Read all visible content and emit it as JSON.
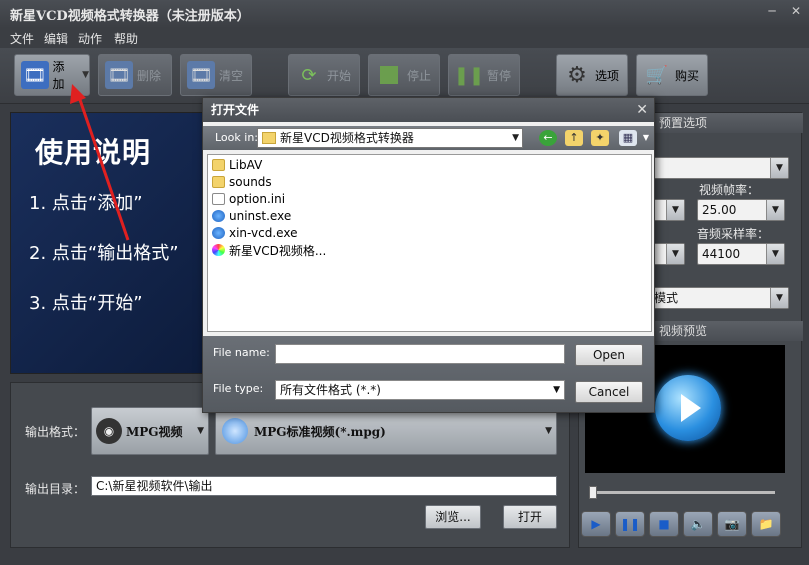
{
  "window": {
    "title": "新星VCD视频格式转换器（未注册版本）"
  },
  "menu": [
    "文件",
    "编辑",
    "动作",
    "帮助"
  ],
  "toolbar": {
    "add": "添加",
    "delete": "删除",
    "clear": "清空",
    "start": "开始",
    "stop": "停止",
    "pause": "暂停",
    "options": "选项",
    "buy": "购买"
  },
  "instructions": {
    "title": "使用说明",
    "step1": "1. 点击“添加”",
    "step2": "2. 点击“输出格式”",
    "step3": "3. 点击“开始”"
  },
  "output": {
    "format_label": "输出格式：",
    "format_value": "MPG视频",
    "preset_value": "MPG标准视频(*.mpg)",
    "dir_label": "输出目录：",
    "dir_value": "C:\\新星视频软件\\输出",
    "browse": "浏览...",
    "open": "打开"
  },
  "right": {
    "preset_header": "预置选项",
    "preset_combo": "",
    "framerate_label": "视频帧率：",
    "framerate_value": "25.00",
    "samplerate_label": "音频采样率：",
    "samplerate_value": "44100",
    "mode_value": "模式",
    "preview_header": "视频预览"
  },
  "dialog": {
    "title": "打开文件",
    "look_in_label": "Look in:",
    "look_in_value": "新星VCD视频格式转换器",
    "files": [
      {
        "name": "LibAV",
        "type": "folder"
      },
      {
        "name": "sounds",
        "type": "folder"
      },
      {
        "name": "option.ini",
        "type": "doc"
      },
      {
        "name": "uninst.exe",
        "type": "app"
      },
      {
        "name": "xin-vcd.exe",
        "type": "app"
      },
      {
        "name": "新星VCD视频格...",
        "type": "color"
      }
    ],
    "file_name_label": "File name:",
    "file_name_value": "",
    "file_type_label": "File type:",
    "file_type_value": "所有文件格式 (*.*)",
    "open": "Open",
    "cancel": "Cancel"
  },
  "colors": {
    "accent": "#2a8fe0",
    "arrow": "#e02020"
  }
}
